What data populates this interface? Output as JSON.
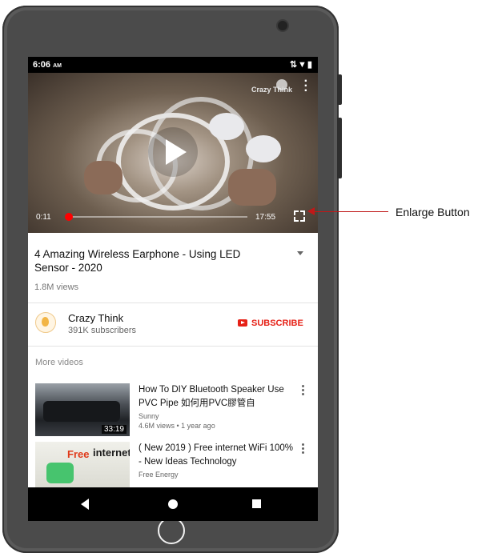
{
  "status_bar": {
    "time": "6:06",
    "ampm": "AM",
    "icons": "⇅▼▮"
  },
  "video_player": {
    "watermark": "Crazy Think",
    "current_time": "0:11",
    "duration": "17:55",
    "progress_fraction": 0.01
  },
  "video_info": {
    "title": "4 Amazing Wireless Earphone - Using LED Sensor - 2020",
    "views": "1.8M views"
  },
  "channel": {
    "name": "Crazy Think",
    "subscribers": "391K subscribers",
    "subscribe_label": "SUBSCRIBE"
  },
  "more_videos": {
    "label": "More videos",
    "items": [
      {
        "title": "How To DIY Bluetooth Speaker Use PVC Pipe 如何用PVC膠管自",
        "channel": "Sunny",
        "meta": "4.6M views • 1 year ago",
        "duration": "33:19"
      },
      {
        "title": "( New 2019 ) Free internet WiFi 100% - New Ideas Technology",
        "channel": "Free Energy",
        "meta": "",
        "thumb_free": "Free",
        "thumb_internet": "internet"
      }
    ]
  },
  "annotation": {
    "label": "Enlarge Button"
  },
  "colors": {
    "accent": "#e62117",
    "callout": "#c01818",
    "device": "#4b4b4b"
  }
}
